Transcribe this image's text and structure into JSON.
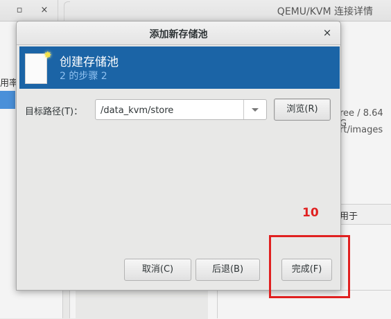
{
  "background_window": {
    "title": "QEMU/KVM 连接详情",
    "controls": {
      "restore": "▫",
      "close": "×"
    },
    "left_label": "用率",
    "free_text": "ree / 8.64 G",
    "path_text": "rt/images",
    "usage_header": "用于"
  },
  "dialog": {
    "title": "添加新存储池",
    "close": "×",
    "banner": {
      "title": "创建存储池",
      "subtitle": "2 的步骤 2",
      "icon": "document-new-icon"
    },
    "target_path": {
      "label": "目标路径(T)：",
      "value": "/data_kvm/store"
    },
    "buttons": {
      "browse": "浏览(R)",
      "cancel": "取消(C)",
      "back": "后退(B)",
      "finish": "完成(F)"
    }
  },
  "annotation": {
    "step_number": "10",
    "color": "#e02020"
  },
  "colors": {
    "banner": "#1b64a6",
    "banner_subtitle": "#8fc1f0",
    "selection": "#4a90d9"
  }
}
